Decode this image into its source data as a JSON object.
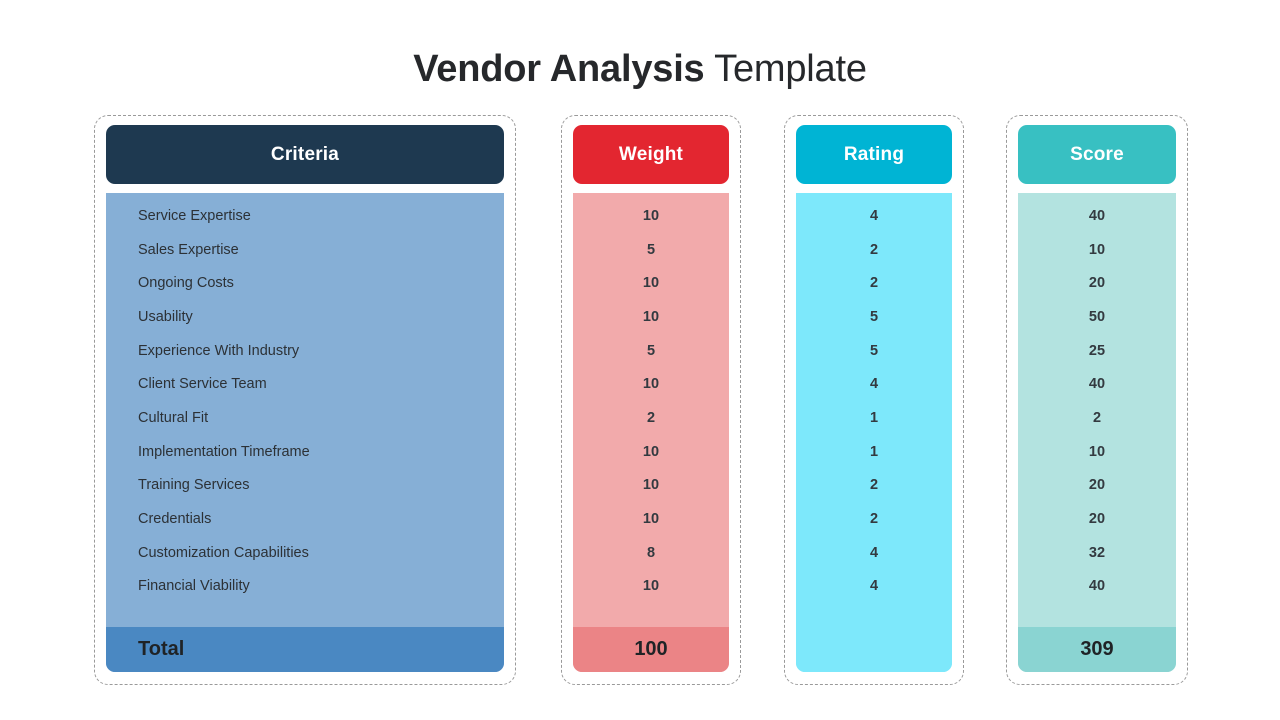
{
  "title": {
    "strong": "Vendor Analysis",
    "light": " Template"
  },
  "colors": {
    "criteria_header": "#1E3950",
    "criteria_body": "#86AFD6",
    "criteria_total": "#4A88C2",
    "weight_header": "#E32630",
    "weight_body": "#F2AAAB",
    "weight_total": "#EB8486",
    "rating_header": "#00B4D4",
    "rating_body": "#7DE8FB",
    "rating_total": "#7DE8FB",
    "score_header": "#38C0C2",
    "score_body": "#B3E3E0",
    "score_total": "#8AD4D2",
    "card_border": "#9A9A9A",
    "page_background": "#FFFFFF",
    "title_text": "#26282B"
  },
  "columns": {
    "criteria": {
      "header": "Criteria",
      "total_label": "Total",
      "rows": [
        "Service Expertise",
        "Sales Expertise",
        "Ongoing Costs",
        "Usability",
        "Experience With Industry",
        "Client Service Team",
        "Cultural Fit",
        "Implementation Timeframe",
        "Training Services",
        "Credentials",
        "Customization Capabilities",
        "Financial Viability"
      ]
    },
    "weight": {
      "header": "Weight",
      "rows": [
        "10",
        "5",
        "10",
        "10",
        "5",
        "10",
        "2",
        "10",
        "10",
        "10",
        "8",
        "10"
      ],
      "total": "100"
    },
    "rating": {
      "header": "Rating",
      "rows": [
        "4",
        "2",
        "2",
        "5",
        "5",
        "4",
        "1",
        "1",
        "2",
        "2",
        "4",
        "4"
      ],
      "total": ""
    },
    "score": {
      "header": "Score",
      "rows": [
        "40",
        "10",
        "20",
        "50",
        "25",
        "40",
        "2",
        "10",
        "20",
        "20",
        "32",
        "40"
      ],
      "total": "309"
    }
  }
}
